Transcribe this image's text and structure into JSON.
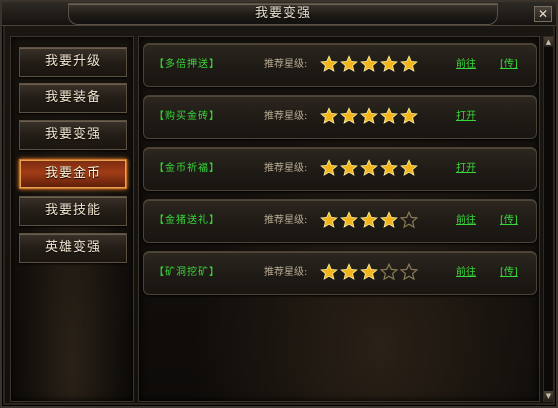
{
  "window": {
    "title": "我要变强",
    "close_label": "✕"
  },
  "sidebar": {
    "items": [
      {
        "label": "我要升级",
        "active": false
      },
      {
        "label": "我要装备",
        "active": false
      },
      {
        "label": "我要变强",
        "active": false
      },
      {
        "label": "我要金币",
        "active": true
      },
      {
        "label": "我要技能",
        "active": false
      },
      {
        "label": "英雄变强",
        "active": false
      }
    ]
  },
  "main": {
    "rows": [
      {
        "name": "【多倍押送】",
        "rating_label": "推荐星级:",
        "stars": 5,
        "action": "前往",
        "transfer": "[传]"
      },
      {
        "name": "【购买金砖】",
        "rating_label": "推荐星级:",
        "stars": 5,
        "action": "打开",
        "transfer": ""
      },
      {
        "name": "【金币祈福】",
        "rating_label": "推荐星级:",
        "stars": 5,
        "action": "打开",
        "transfer": ""
      },
      {
        "name": "【金猪送礼】",
        "rating_label": "推荐星级:",
        "stars": 4,
        "action": "前往",
        "transfer": "[传]"
      },
      {
        "name": "【矿洞挖矿】",
        "rating_label": "推荐星级:",
        "stars": 3,
        "action": "前往",
        "transfer": "[传]"
      }
    ],
    "max_stars": 5
  },
  "colors": {
    "accent_green": "#39d83a",
    "star_gold": "#f2b51d",
    "active_button": "#a13c15"
  }
}
